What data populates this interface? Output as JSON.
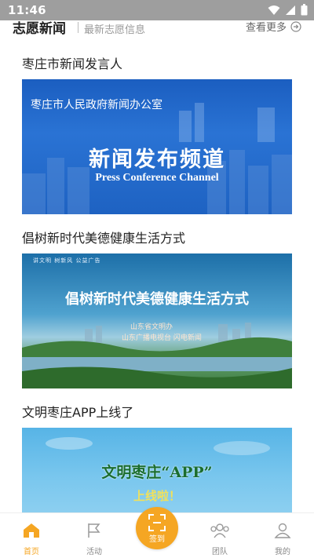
{
  "status": {
    "time": "11:46"
  },
  "section": {
    "title": "志愿新闻",
    "subtitle": "最新志愿信息",
    "more_label": "查看更多"
  },
  "news": [
    {
      "title": "枣庄市新闻发言人",
      "image_office": "枣庄市人民政府新闻办公室",
      "image_main": "新闻发布频道",
      "image_sub": "Press Conference Channel"
    },
    {
      "title": "倡树新时代美德健康生活方式",
      "image_tagline": "讲文明 树新风 公益广告",
      "image_main": "倡树新时代美德健康生活方式",
      "image_credit1": "山东省文明办",
      "image_credit2": "山东广播电视台 闪电新闻"
    },
    {
      "title": "文明枣庄APP上线了",
      "image_main": "文明枣庄“APP”",
      "image_sub": "上线啦！"
    }
  ],
  "tabbar": {
    "home": "首页",
    "activity": "活动",
    "checkin": "签到",
    "team": "团队",
    "mine": "我的",
    "active_color": "#f5a623"
  }
}
